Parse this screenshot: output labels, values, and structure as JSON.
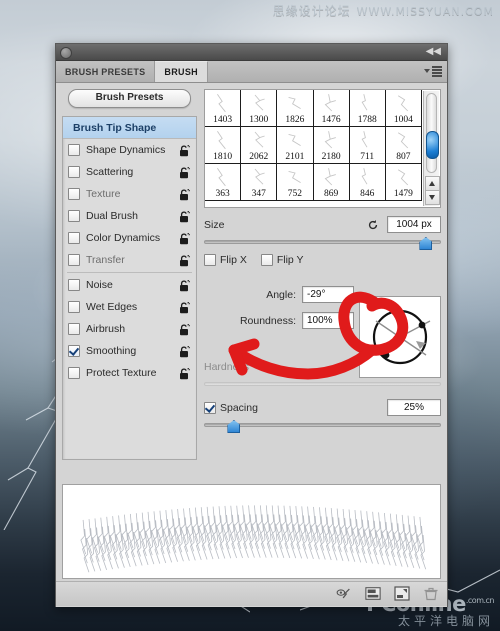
{
  "watermark": {
    "top_cn": "思缘设计论坛",
    "top_url": "WWW.MISSYUAN.COM",
    "bottom_brand": "PConline",
    "bottom_brand_suffix": ".com.cn",
    "bottom_cn": "太平洋电脑网"
  },
  "panel": {
    "collapse_icon": "double-chevron-left-icon",
    "menu_icon": "panel-menu-icon",
    "close_icon": "close-dot-icon",
    "tabs": [
      {
        "label": "BRUSH PRESETS",
        "active": false
      },
      {
        "label": "BRUSH",
        "active": true
      }
    ],
    "presets_button": "Brush Presets"
  },
  "options": {
    "header": "Brush Tip Shape",
    "items": [
      {
        "label": "Shape Dynamics",
        "checked": false,
        "locked": true,
        "dim": false
      },
      {
        "label": "Scattering",
        "checked": false,
        "locked": true,
        "dim": false
      },
      {
        "label": "Texture",
        "checked": false,
        "locked": true,
        "dim": true
      },
      {
        "label": "Dual Brush",
        "checked": false,
        "locked": true,
        "dim": false
      },
      {
        "label": "Color Dynamics",
        "checked": false,
        "locked": true,
        "dim": false
      },
      {
        "label": "Transfer",
        "checked": false,
        "locked": true,
        "dim": true
      },
      {
        "label": "Noise",
        "checked": false,
        "locked": true,
        "dim": false
      },
      {
        "label": "Wet Edges",
        "checked": false,
        "locked": true,
        "dim": false
      },
      {
        "label": "Airbrush",
        "checked": false,
        "locked": true,
        "dim": false
      },
      {
        "label": "Smoothing",
        "checked": true,
        "locked": true,
        "dim": false
      },
      {
        "label": "Protect Texture",
        "checked": false,
        "locked": true,
        "dim": false
      }
    ]
  },
  "brush_grid": {
    "rows": [
      [
        "1403",
        "1300",
        "1826",
        "1476",
        "1788",
        "1004"
      ],
      [
        "1810",
        "2062",
        "2101",
        "2180",
        "711",
        "807"
      ],
      [
        "363",
        "347",
        "752",
        "869",
        "846",
        "1479"
      ]
    ],
    "scroll_thumb_position_pct": 52,
    "scroll_up_icon": "scroll-up-arrow-icon",
    "scroll_down_icon": "scroll-down-arrow-icon"
  },
  "controls": {
    "size_label": "Size",
    "size_value": "1004 px",
    "size_slider_pct": 93,
    "size_reset_icon": "reset-size-icon",
    "flip_x_label": "Flip X",
    "flip_x_checked": false,
    "flip_y_label": "Flip Y",
    "flip_y_checked": false,
    "angle_label": "Angle:",
    "angle_value": "-29°",
    "roundness_label": "Roundness:",
    "roundness_value": "100%",
    "hardness_label": "Hardness",
    "hardness_value": "",
    "hardness_enabled": false,
    "hardness_slider_pct": 0,
    "spacing_label": "Spacing",
    "spacing_checked": true,
    "spacing_value": "25%",
    "spacing_slider_pct": 12
  },
  "footer": {
    "icons": [
      "toggle-airbrush-icon",
      "brush-panel-toggle-icon",
      "new-brush-icon",
      "delete-brush-icon"
    ]
  },
  "annotation": {
    "color": "#e01b1b",
    "shapes": [
      "hand-drawn-circle",
      "hand-drawn-arrow"
    ]
  }
}
